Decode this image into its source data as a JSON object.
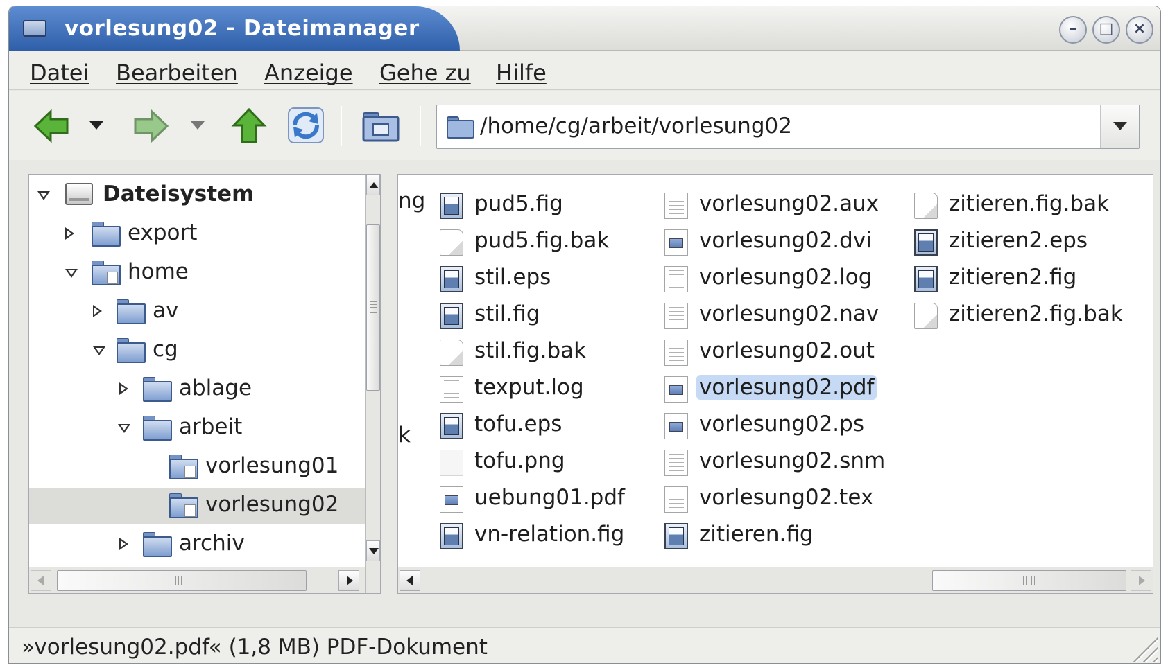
{
  "window": {
    "title": "vorlesung02 - Dateimanager",
    "title_bar_color": "#2f5fa8",
    "controls": [
      "minimize-icon",
      "maximize-icon",
      "close-icon"
    ]
  },
  "menu": {
    "items": [
      "Datei",
      "Bearbeiten",
      "Anzeige",
      "Gehe zu",
      "Hilfe"
    ]
  },
  "toolbar": {
    "buttons": [
      "back-icon",
      "back-history-dropdown",
      "forward-icon",
      "forward-history-dropdown",
      "up-icon",
      "reload-icon",
      "home-folder-icon"
    ],
    "path": "/home/cg/arbeit/vorlesung02"
  },
  "sidebar": {
    "root": "Dateisystem",
    "items": [
      {
        "label": "export",
        "expanded": false
      },
      {
        "label": "home",
        "expanded": true
      },
      {
        "label": "av",
        "expanded": false
      },
      {
        "label": "cg",
        "expanded": true
      },
      {
        "label": "ablage",
        "expanded": false
      },
      {
        "label": "arbeit",
        "expanded": true
      },
      {
        "label": "vorlesung01",
        "expanded": null
      },
      {
        "label": "vorlesung02",
        "expanded": null,
        "selected": true
      },
      {
        "label": "archiv",
        "expanded": false
      }
    ]
  },
  "files": {
    "partial_left": [
      "ng",
      "k"
    ],
    "columns": [
      [
        {
          "name": "pud5.fig",
          "icon": "image-icon"
        },
        {
          "name": "pud5.fig.bak",
          "icon": "blank-file-icon"
        },
        {
          "name": "stil.eps",
          "icon": "image-icon"
        },
        {
          "name": "stil.fig",
          "icon": "image-icon"
        },
        {
          "name": "stil.fig.bak",
          "icon": "blank-file-icon"
        },
        {
          "name": "texput.log",
          "icon": "text-file-icon"
        },
        {
          "name": "tofu.eps",
          "icon": "image-icon"
        },
        {
          "name": "tofu.png",
          "icon": "png-file-icon"
        },
        {
          "name": "uebung01.pdf",
          "icon": "pdf-file-icon"
        },
        {
          "name": "vn-relation.fig",
          "icon": "image-icon"
        }
      ],
      [
        {
          "name": "vorlesung02.aux",
          "icon": "text-file-icon"
        },
        {
          "name": "vorlesung02.dvi",
          "icon": "pdf-file-icon"
        },
        {
          "name": "vorlesung02.log",
          "icon": "text-file-icon"
        },
        {
          "name": "vorlesung02.nav",
          "icon": "text-file-icon"
        },
        {
          "name": "vorlesung02.out",
          "icon": "text-file-icon"
        },
        {
          "name": "vorlesung02.pdf",
          "icon": "pdf-file-icon",
          "selected": true
        },
        {
          "name": "vorlesung02.ps",
          "icon": "pdf-file-icon"
        },
        {
          "name": "vorlesung02.snm",
          "icon": "text-file-icon"
        },
        {
          "name": "vorlesung02.tex",
          "icon": "text-file-icon"
        },
        {
          "name": "zitieren.fig",
          "icon": "image-icon"
        }
      ],
      [
        {
          "name": "zitieren.fig.bak",
          "icon": "blank-file-icon"
        },
        {
          "name": "zitieren2.eps",
          "icon": "image-icon"
        },
        {
          "name": "zitieren2.fig",
          "icon": "image-icon"
        },
        {
          "name": "zitieren2.fig.bak",
          "icon": "blank-file-icon"
        }
      ]
    ],
    "selection_color": "#c6daf5"
  },
  "status": {
    "text": "»vorlesung02.pdf« (1,8 MB) PDF-Dokument"
  }
}
